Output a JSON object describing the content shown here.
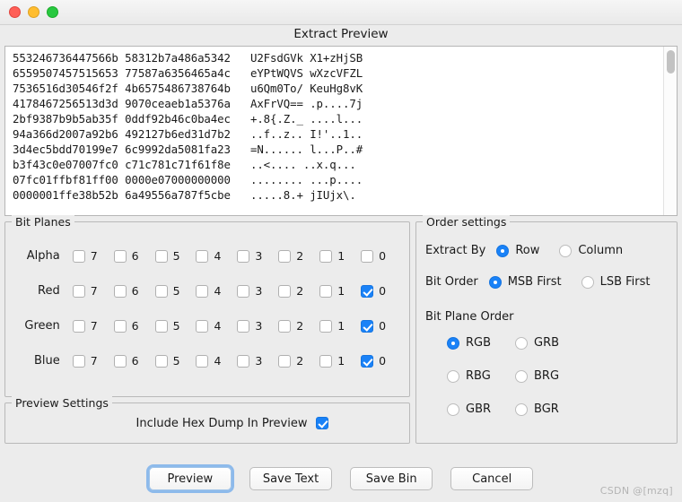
{
  "window": {
    "title": "Extract Preview",
    "traffic_lights": [
      "close-button",
      "minimize-button",
      "maximize-button"
    ]
  },
  "preview": {
    "hexdump_lines": [
      "553246736447566b 58312b7a486a5342   U2FsdGVk X1+zHjSB",
      "6559507457515653 77587a6356465a4c   eYPtWQVS wXzcVFZL",
      "7536516d30546f2f 4b6575486738764b   u6Qm0To/ KeuHg8vK",
      "4178467256513d3d 9070ceaeb1a5376a   AxFrVQ== .p....7j",
      "2bf9387b9b5ab35f 0ddf92b46c0ba4ec   +.8{.Z._ ....l...",
      "94a366d2007a92b6 492127b6ed31d7b2   ..f..z.. I!'..1..",
      "3d4ec5bdd70199e7 6c9992da5081fa23   =N...... l...P..#",
      "b3f43c0e07007fc0 c71c781c71f61f8e   ..<.... ..x.q...",
      "07fc01ffbf81ff00 0000e07000000000   ........ ...p....",
      "0000001ffe38b52b 6a49556a787f5cbe   .....8.+ jIUjx\\."
    ],
    "scrollbar": "vertical-scrollbar"
  },
  "bit_planes": {
    "legend": "Bit Planes",
    "bit_labels": [
      "7",
      "6",
      "5",
      "4",
      "3",
      "2",
      "1",
      "0"
    ],
    "channels": [
      {
        "label": "Alpha",
        "checked": [
          false,
          false,
          false,
          false,
          false,
          false,
          false,
          false
        ]
      },
      {
        "label": "Red",
        "checked": [
          false,
          false,
          false,
          false,
          false,
          false,
          false,
          true
        ]
      },
      {
        "label": "Green",
        "checked": [
          false,
          false,
          false,
          false,
          false,
          false,
          false,
          true
        ]
      },
      {
        "label": "Blue",
        "checked": [
          false,
          false,
          false,
          false,
          false,
          false,
          false,
          true
        ]
      }
    ]
  },
  "preview_settings": {
    "legend": "Preview Settings",
    "include_hex_dump_label": "Include Hex Dump In Preview",
    "include_hex_dump_checked": true
  },
  "order_settings": {
    "legend": "Order settings",
    "extract_by": {
      "label": "Extract By",
      "options": [
        "Row",
        "Column"
      ],
      "selected": "Row"
    },
    "bit_order": {
      "label": "Bit Order",
      "options": [
        "MSB First",
        "LSB First"
      ],
      "selected": "MSB First"
    },
    "bit_plane_order": {
      "label": "Bit Plane Order",
      "options": [
        "RGB",
        "GRB",
        "RBG",
        "BRG",
        "GBR",
        "BGR"
      ],
      "selected": "RGB"
    }
  },
  "buttons": [
    {
      "label": "Preview",
      "focused": true
    },
    {
      "label": "Save Text",
      "focused": false
    },
    {
      "label": "Save Bin",
      "focused": false
    },
    {
      "label": "Cancel",
      "focused": false
    }
  ],
  "watermark": "CSDN @[mzq]",
  "colors": {
    "accent": "#1a82f7",
    "window_bg": "#ececec",
    "text_bg": "#ffffff",
    "border": "#b9b9b9",
    "close": "#ff5f57",
    "minimize": "#ffbd2e",
    "maximize": "#28c840"
  }
}
